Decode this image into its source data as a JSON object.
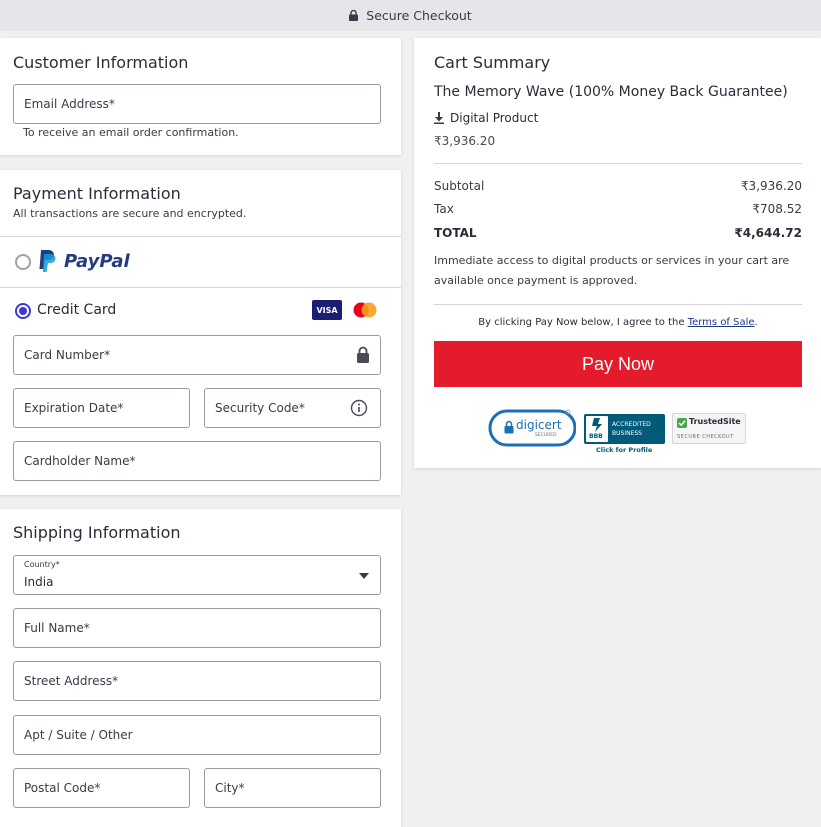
{
  "topbar": {
    "title": "Secure Checkout"
  },
  "customer": {
    "title": "Customer Information",
    "email_placeholder": "Email Address*",
    "email_help": "To receive an email order confirmation."
  },
  "payment": {
    "title": "Payment Information",
    "subtitle": "All transactions are secure and encrypted.",
    "paypal_label": "PayPal",
    "credit_label": "Credit Card",
    "visa_label": "VISA",
    "card_number_placeholder": "Card Number*",
    "expiration_placeholder": "Expiration Date*",
    "security_placeholder": "Security Code*",
    "cardholder_placeholder": "Cardholder Name*",
    "selected_method": "credit-card"
  },
  "shipping": {
    "title": "Shipping Information",
    "country_label": "Country*",
    "country_value": "India",
    "full_name_placeholder": "Full Name*",
    "street_placeholder": "Street Address*",
    "apt_placeholder": "Apt / Suite / Other",
    "postal_placeholder": "Postal Code*",
    "city_placeholder": "City*"
  },
  "cart": {
    "title": "Cart Summary",
    "product_name": "The Memory Wave (100% Money Back Guarantee)",
    "product_type": "Digital Product",
    "product_price": "₹3,936.20",
    "subtotal_label": "Subtotal",
    "subtotal_value": "₹3,936.20",
    "tax_label": "Tax",
    "tax_value": "₹708.52",
    "total_label": "TOTAL",
    "total_value": "₹4,644.72",
    "access_note": "Immediate access to digital products or services in your cart are available once payment is approved.",
    "agree_text": "By clicking Pay Now below, I agree to the",
    "terms_link": "Terms of Sale",
    "agree_end": ".",
    "pay_button": "Pay Now"
  },
  "badges": {
    "digicert": "digicert",
    "digicert_sub": "SECURED",
    "bbb_line1": "ACCREDITED",
    "bbb_line2": "BUSINESS",
    "bbb_logo": "BBB",
    "bbb_profile": "Click for Profile",
    "trusted": "TrustedSite",
    "trusted_sub": "SECURE CHECKOUT"
  },
  "colors": {
    "accent": "#3b3bd1",
    "pay_button": "#e31b2d",
    "paypal_dark": "#253b80",
    "paypal_light": "#179bd7"
  }
}
